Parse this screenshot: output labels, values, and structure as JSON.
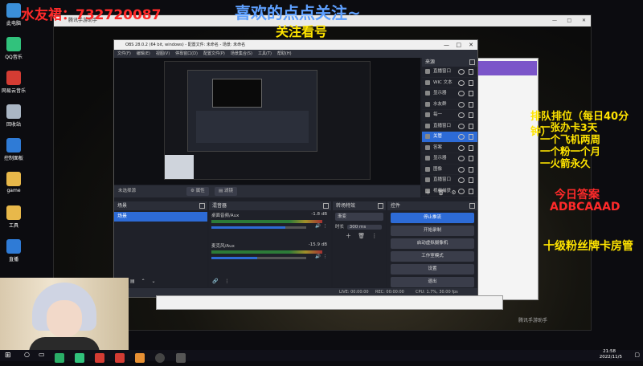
{
  "overlay": {
    "qq_group": "水友裙：732720087",
    "top_title_1": "喜欢的点点关注~",
    "top_title_2": "关注看号",
    "ranking_title": "排队排位（每日40分钟）",
    "ranking_lines": [
      "一张办卡3天",
      "一个飞机两周",
      "一个粉一个月",
      "一火箭永久"
    ],
    "today_answer_label": "今日答案",
    "today_answer": "ADBCAAAD",
    "fan_badge": "十级粉丝牌卡房管"
  },
  "desktop": {
    "icons": [
      {
        "label": "此电脑",
        "color": "#3b8fd9"
      },
      {
        "label": "QQ音乐",
        "color": "#31c27c"
      },
      {
        "label": "网易云音乐",
        "color": "#d43c33"
      },
      {
        "label": "回收站",
        "color": "#aab6c4"
      },
      {
        "label": "控制面板",
        "color": "#2f7bd6"
      },
      {
        "label": "game",
        "color": "#e8b84a"
      },
      {
        "label": "工具",
        "color": "#e8b84a"
      },
      {
        "label": "直播",
        "color": "#2f7bd6"
      }
    ]
  },
  "obs": {
    "title": "OBS 28.0.2 (64 bit, windows) - 配置文件: 未命名 - 场景: 未命名",
    "menu": [
      "文件(F)",
      "编辑(E)",
      "视图(V)",
      "停靠窗口(D)",
      "配置文件(P)",
      "场景集合(S)",
      "工具(T)",
      "帮助(H)"
    ],
    "no_source_selected": "未选择源",
    "props_button": "属性",
    "filters_button": "滤镜",
    "sources_title": "来源",
    "sources": [
      {
        "name": "直播窗口",
        "selected": false
      },
      {
        "name": "WIC 文本",
        "selected": false
      },
      {
        "name": "显示器",
        "selected": false
      },
      {
        "name": "水友群",
        "selected": false
      },
      {
        "name": "每一",
        "selected": false
      },
      {
        "name": "直播窗口",
        "selected": false
      },
      {
        "name": "关管",
        "selected": true
      },
      {
        "name": "答案",
        "selected": false
      },
      {
        "name": "显示器",
        "selected": false
      },
      {
        "name": "图像",
        "selected": false
      },
      {
        "name": "直播窗口",
        "selected": false
      },
      {
        "name": "视频捕获",
        "selected": false
      }
    ],
    "scenes_title": "场景",
    "scenes": [
      "场景"
    ],
    "mixer_title": "混音器",
    "mixer": [
      {
        "name": "桌面音频/Aux",
        "db": "-1.8 dB",
        "level": 0.78
      },
      {
        "name": "麦克风/Aux",
        "db": "-15.9 dB",
        "level": 0.48
      }
    ],
    "transitions_title": "转场特效",
    "transition_type": "渐变",
    "duration_label": "时长",
    "duration_value": "300 ms",
    "controls_title": "控件",
    "controls": [
      "停止推流",
      "开始录制",
      "启动虚拟摄像机",
      "工作室模式",
      "设置",
      "退出"
    ],
    "status": {
      "live": "LIVE: 00:00:00",
      "rec": "REC: 00:00:00",
      "cpu": "CPU: 1.7%, 30.00 fps"
    }
  },
  "browser": {
    "title": "腾讯手游助手"
  },
  "watermark": "腾讯手游助手",
  "taskbar": {
    "time": "21:58",
    "date": "2022/11/5"
  },
  "colors": {
    "accent": "#2d6bd6",
    "overlay_red": "#ff2a2a",
    "overlay_yellow": "#ffe400"
  }
}
